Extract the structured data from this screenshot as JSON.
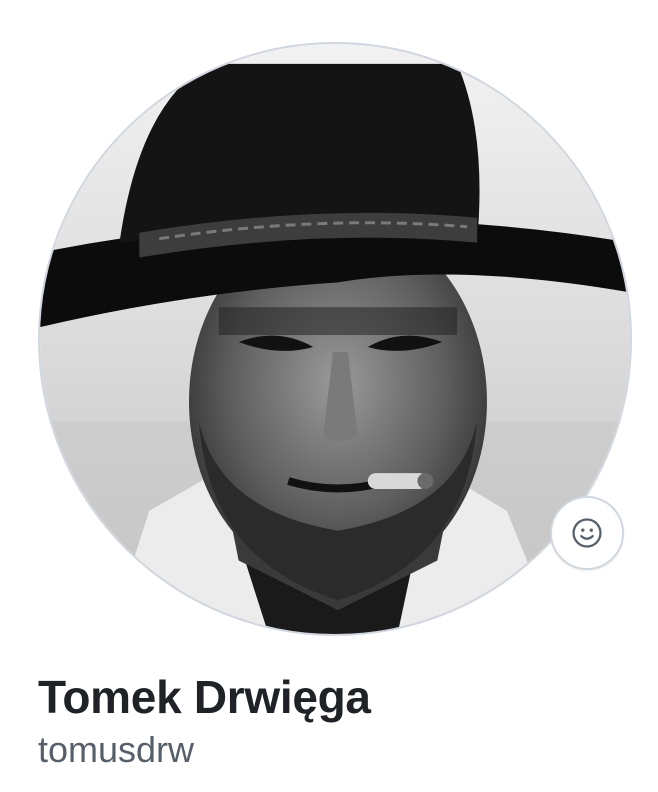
{
  "profile": {
    "display_name": "Tomek Drwięga",
    "username": "tomusdrw",
    "avatar_icon": "portrait-avatar",
    "status_icon": "smiley-icon"
  },
  "colors": {
    "border": "#d0d7de",
    "name": "#1f2328",
    "username": "#57606a",
    "icon": "#57606a"
  }
}
